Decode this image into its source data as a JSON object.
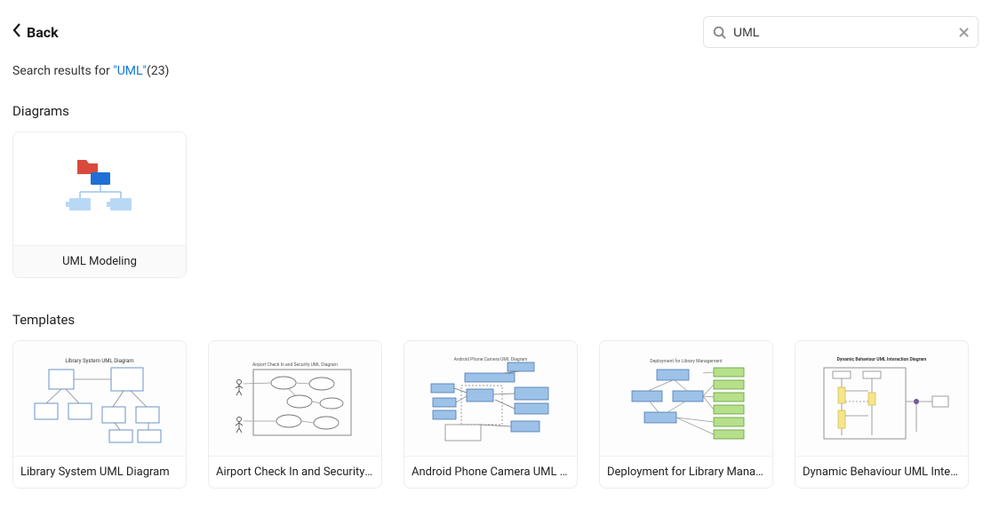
{
  "header": {
    "back_label": "Back"
  },
  "search": {
    "value": "UML"
  },
  "results": {
    "prefix": "Search results for ",
    "query_display": "\"UML\"",
    "count_display": "(23)"
  },
  "sections": {
    "diagrams_heading": "Diagrams",
    "templates_heading": "Templates"
  },
  "diagrams": [
    {
      "label": "UML Modeling"
    }
  ],
  "templates": [
    {
      "label": "Library System UML Diagram"
    },
    {
      "label": "Airport Check In and Security U..."
    },
    {
      "label": "Android Phone Camera UML Dia..."
    },
    {
      "label": "Deployment for Library Manage..."
    },
    {
      "label": "Dynamic Behaviour UML Interac..."
    }
  ]
}
